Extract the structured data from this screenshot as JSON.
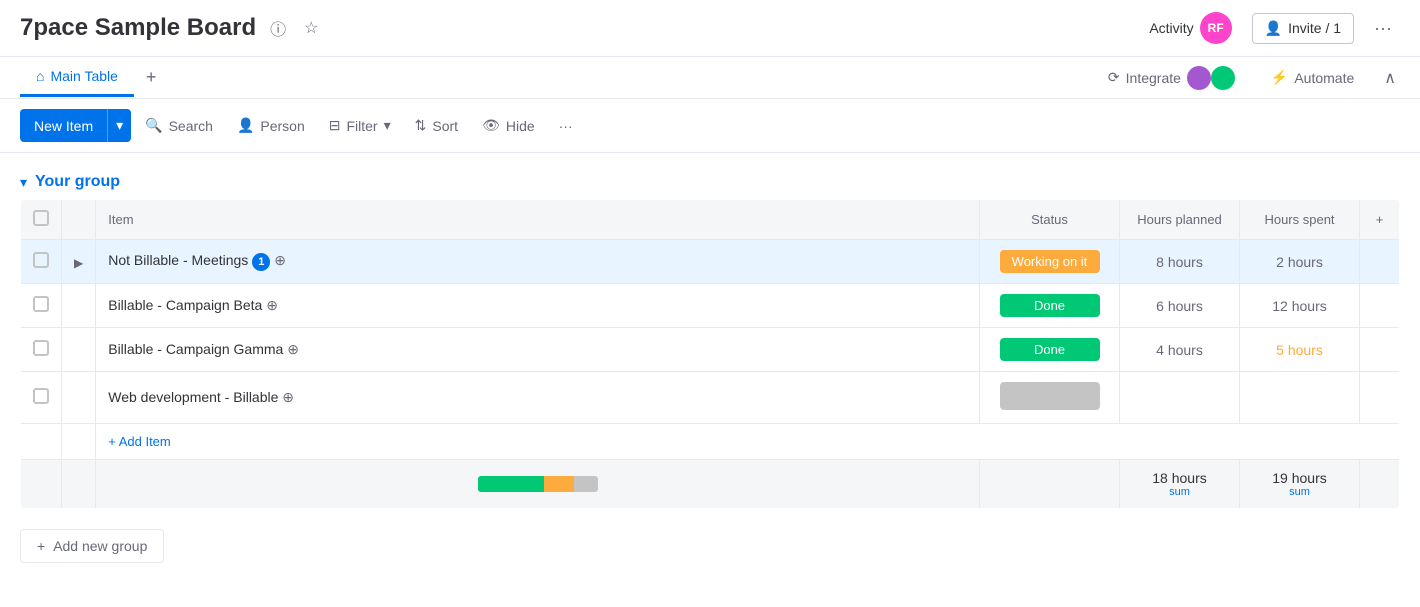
{
  "app": {
    "title": "7pace Sample Board",
    "info_icon": "ℹ",
    "star_icon": "☆"
  },
  "top_bar": {
    "activity_label": "Activity",
    "avatar_initials": "RF",
    "invite_label": "Invite / 1",
    "more_icon": "···"
  },
  "tab_bar": {
    "tabs": [
      {
        "label": "Main Table",
        "active": true
      }
    ],
    "add_tab": "+",
    "integrate_label": "Integrate",
    "automate_label": "Automate",
    "collapse_icon": "∧"
  },
  "toolbar": {
    "new_item_label": "New Item",
    "new_item_arrow": "▾",
    "search_label": "Search",
    "person_label": "Person",
    "filter_label": "Filter",
    "filter_arrow": "▾",
    "sort_label": "Sort",
    "hide_label": "Hide",
    "more_icon": "···"
  },
  "group": {
    "chevron": "▾",
    "title": "Your group"
  },
  "table": {
    "columns": [
      "",
      "",
      "Item",
      "Status",
      "Hours planned",
      "Hours spent",
      "+"
    ],
    "rows": [
      {
        "id": 1,
        "expand": true,
        "item": "Not Billable - Meetings",
        "badge": "1",
        "status": "Working on it",
        "status_type": "working",
        "hours_planned": "8 hours",
        "hours_spent": "2 hours",
        "hours_spent_type": "normal",
        "active": true
      },
      {
        "id": 2,
        "expand": false,
        "item": "Billable - Campaign Beta",
        "badge": "",
        "status": "Done",
        "status_type": "done",
        "hours_planned": "6 hours",
        "hours_spent": "12 hours",
        "hours_spent_type": "normal",
        "active": false
      },
      {
        "id": 3,
        "expand": false,
        "item": "Billable - Campaign Gamma",
        "badge": "",
        "status": "Done",
        "status_type": "done",
        "hours_planned": "4 hours",
        "hours_spent": "5 hours",
        "hours_spent_type": "orange",
        "active": false
      },
      {
        "id": 4,
        "expand": false,
        "item": "Web development - Billable",
        "badge": "",
        "status": "",
        "status_type": "empty",
        "hours_planned": "",
        "hours_spent": "",
        "hours_spent_type": "normal",
        "active": false
      }
    ],
    "add_item_label": "+ Add Item",
    "sum": {
      "progress_bar": [
        {
          "type": "green",
          "pct": 55
        },
        {
          "type": "orange",
          "pct": 25
        },
        {
          "type": "gray",
          "pct": 20
        }
      ],
      "hours_planned": "18 hours",
      "hours_planned_sub": "sum",
      "hours_spent": "19 hours",
      "hours_spent_sub": "sum"
    }
  },
  "add_group": {
    "label": "Add new group",
    "icon": "+"
  }
}
